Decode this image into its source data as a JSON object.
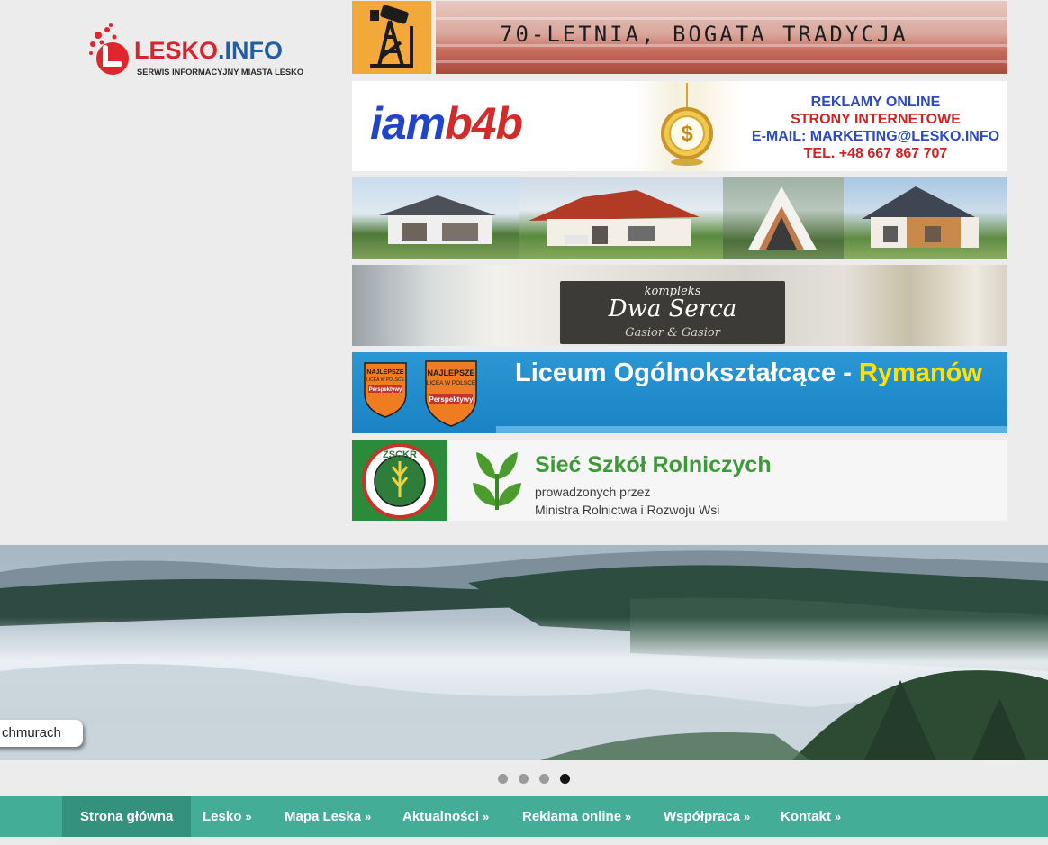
{
  "logo": {
    "name_part1": "LESKO",
    "name_part2": ".INFO",
    "tagline": "SERWIS INFORMACYJNY MIASTA LESKO",
    "colors": {
      "red": "#d8242c",
      "blue": "#1f5fa8"
    }
  },
  "banners": {
    "drilling": {
      "slogan": "70-LETNIA, BOGATA TRADYCJA",
      "icon": "oil-pump-icon"
    },
    "iam": {
      "brand_part1": "iam",
      "brand_part2": "b4b",
      "lines": [
        "REKLAMY ONLINE",
        "STRONY INTERNETOWE",
        "E-MAIL: MARKETING@LESKO.INFO",
        "TEL. +48 667 867 707"
      ]
    },
    "houses": {
      "count": 4
    },
    "dwa_serca": {
      "small": "kompleks",
      "big": "Dwa Serca",
      "sub": "Gasior & Gasior"
    },
    "liceum": {
      "title_main": "Liceum Ogólnokształcące - ",
      "title_accent": "Rymanów",
      "badge_top": "NAJLEPSZE",
      "badge_mid": "LICEA W POLSCE",
      "badge_label": "Perspektywy"
    },
    "szkoly": {
      "seal_text": "ZSCKR",
      "title": "Sieć Szkół Rolniczych",
      "line1": "prowadzonych przez",
      "line2": "Ministra Rolnictwa i Rozwoju Wsi"
    }
  },
  "slider": {
    "caption": "chmurach",
    "active_slide": 4,
    "dots": [
      "1",
      "2",
      "3",
      "4"
    ]
  },
  "nav": {
    "items": [
      {
        "label": "Strona główna",
        "has_arrow": false,
        "active": true
      },
      {
        "label": "Lesko",
        "has_arrow": true
      },
      {
        "label": "Mapa Leska",
        "has_arrow": true
      },
      {
        "label": "Aktualności",
        "has_arrow": true
      },
      {
        "label": "Reklama online",
        "has_arrow": true
      },
      {
        "label": "Współpraca",
        "has_arrow": true
      },
      {
        "label": "Kontakt",
        "has_arrow": true
      }
    ],
    "arrow_glyph": "»",
    "bg_color": "#44ad97"
  }
}
